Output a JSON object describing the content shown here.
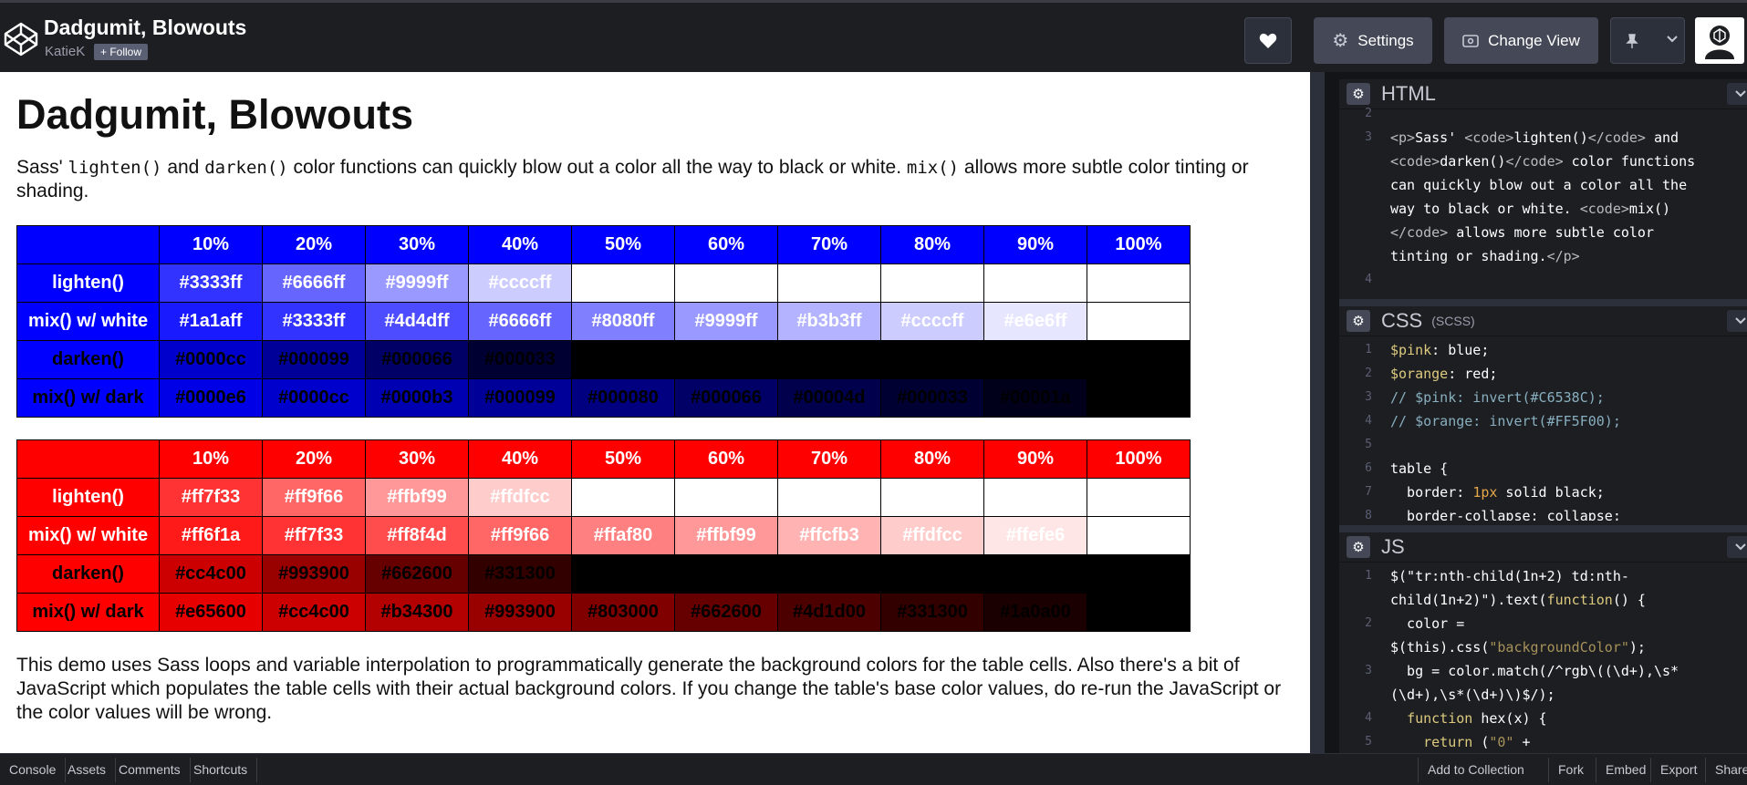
{
  "header": {
    "title": "Dadgumit, Blowouts",
    "author": "KatieK",
    "follow_label": "+ Follow",
    "settings_label": "Settings",
    "change_view_label": "Change View"
  },
  "preview": {
    "heading": "Dadgumit, Blowouts",
    "intro_a": "Sass' ",
    "intro_code1": "lighten()",
    "intro_b": " and ",
    "intro_code2": "darken()",
    "intro_c": " color functions can quickly blow out a color all the way to black or white. ",
    "intro_code3": "mix()",
    "intro_d": " allows more subtle color tinting or shading.",
    "outro": "This demo uses Sass loops and variable interpolation to programmatically generate the background colors for the table cells. Also there's a bit of JavaScript which populates the table cells with their actual background colors. If you change the table's base color values, do re-run the JavaScript or the color values will be wrong.",
    "percent_headers": [
      "10%",
      "20%",
      "30%",
      "40%",
      "50%",
      "60%",
      "70%",
      "80%",
      "90%",
      "100%"
    ],
    "row_labels": [
      "lighten()",
      "mix() w/ white",
      "darken()",
      "mix() w/ dark"
    ],
    "blue_table": {
      "base": "#0000ff",
      "rows": [
        [
          "#3333ff",
          "#6666ff",
          "#9999ff",
          "#ccccff",
          "",
          "",
          "",
          "",
          "",
          ""
        ],
        [
          "#1a1aff",
          "#3333ff",
          "#4d4dff",
          "#6666ff",
          "#8080ff",
          "#9999ff",
          "#b3b3ff",
          "#ccccff",
          "#e6e6ff",
          ""
        ],
        [
          "#0000cc",
          "#000099",
          "#000066",
          "#000033",
          "",
          "",
          "",
          "",
          "",
          ""
        ],
        [
          "#0000e6",
          "#0000cc",
          "#0000b3",
          "#000099",
          "#000080",
          "#000066",
          "#00004d",
          "#000033",
          "#00001a",
          ""
        ]
      ],
      "fills": [
        [
          "#3333ff",
          "#6666ff",
          "#9999ff",
          "#ccccff",
          "#ffffff",
          "#ffffff",
          "#ffffff",
          "#ffffff",
          "#ffffff",
          "#ffffff"
        ],
        [
          "#1a1aff",
          "#3333ff",
          "#4d4dff",
          "#6666ff",
          "#8080ff",
          "#9999ff",
          "#b3b3ff",
          "#ccccff",
          "#e6e6ff",
          "#ffffff"
        ],
        [
          "#0000cc",
          "#000099",
          "#000066",
          "#000033",
          "#000000",
          "#000000",
          "#000000",
          "#000000",
          "#000000",
          "#000000"
        ],
        [
          "#0000e6",
          "#0000cc",
          "#0000b3",
          "#000099",
          "#000080",
          "#000066",
          "#00004d",
          "#000033",
          "#00001a",
          "#000000"
        ]
      ]
    },
    "red_table": {
      "base": "#ff0000",
      "rows": [
        [
          "#ff7f33",
          "#ff9f66",
          "#ffbf99",
          "#ffdfcc",
          "",
          "",
          "",
          "",
          "",
          ""
        ],
        [
          "#ff6f1a",
          "#ff7f33",
          "#ff8f4d",
          "#ff9f66",
          "#ffaf80",
          "#ffbf99",
          "#ffcfb3",
          "#ffdfcc",
          "#ffefe6",
          ""
        ],
        [
          "#cc4c00",
          "#993900",
          "#662600",
          "#331300",
          "",
          "",
          "",
          "",
          "",
          ""
        ],
        [
          "#e65600",
          "#cc4c00",
          "#b34300",
          "#993900",
          "#803000",
          "#662600",
          "#4d1d00",
          "#331300",
          "#1a0a00",
          ""
        ]
      ],
      "fills": [
        [
          "#ff3333",
          "#ff6666",
          "#ff9999",
          "#ffcccc",
          "#ffffff",
          "#ffffff",
          "#ffffff",
          "#ffffff",
          "#ffffff",
          "#ffffff"
        ],
        [
          "#ff1a1a",
          "#ff3333",
          "#ff4d4d",
          "#ff6666",
          "#ff8080",
          "#ff9999",
          "#ffb3b3",
          "#ffcccc",
          "#ffe6e6",
          "#ffffff"
        ],
        [
          "#cc0000",
          "#990000",
          "#660000",
          "#330000",
          "#000000",
          "#000000",
          "#000000",
          "#000000",
          "#000000",
          "#000000"
        ],
        [
          "#e60000",
          "#cc0000",
          "#b30000",
          "#990000",
          "#800000",
          "#660000",
          "#4d0000",
          "#330000",
          "#1a0000",
          "#000000"
        ]
      ]
    }
  },
  "editors": {
    "html": {
      "title": "HTML",
      "line_numbers": [
        "2",
        "3",
        "",
        "",
        "",
        "",
        "",
        "4"
      ],
      "lines": [
        "",
        "<p>Sass' <code>lighten()</code> and",
        "<code>darken()</code> color functions",
        "can quickly blow out a color all the",
        "way to black or white. <code>mix()",
        "</code> allows more subtle color",
        "tinting or shading.</p>",
        ""
      ]
    },
    "css": {
      "title": "CSS",
      "subtitle": "(SCSS)",
      "line_numbers": [
        "1",
        "2",
        "3",
        "4",
        "5",
        "6",
        "7",
        "8"
      ],
      "lines": [
        "$pink: blue;",
        "$orange: red;",
        "// $pink: invert(#C6538C);",
        "// $orange: invert(#FF5F00);",
        "",
        "table {",
        "  border: 1px solid black;",
        "  border-collapse: collapse;"
      ]
    },
    "js": {
      "title": "JS",
      "line_numbers": [
        "1",
        "",
        "2",
        "",
        "3",
        "",
        "4",
        "5"
      ],
      "lines": [
        "$(\"tr:nth-child(1n+2) td:nth-",
        "child(1n+2)\").text(function() {",
        "  color =",
        "$(this).css(\"backgroundColor\");",
        "  bg = color.match(/^rgb\\((\\d+),\\s*",
        "(\\d+),\\s*(\\d+)\\)$/);",
        "  function hex(x) {",
        "    return (\"0\" +"
      ]
    }
  },
  "footer": {
    "left": [
      "Console",
      "Assets",
      "Comments",
      "Shortcuts"
    ],
    "right": [
      "Add to Collection",
      "Fork",
      "Embed",
      "Export",
      "Share"
    ]
  },
  "colors": {
    "header_bg": "#1d1e22",
    "button_bg": "#444857",
    "code_tag": "#bbbbbb",
    "code_keyword": "#ddca7e",
    "code_string": "#a7925a",
    "code_comment": "#88afbf"
  }
}
